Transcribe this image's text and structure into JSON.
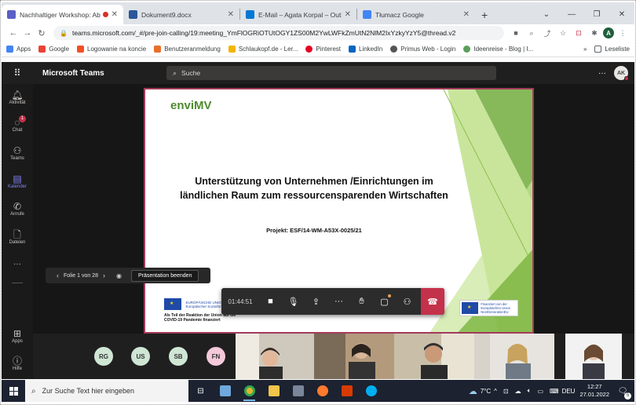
{
  "browser": {
    "tabs": [
      {
        "title": "Nachhaltiger Workshop: Abla",
        "active": true,
        "recording": true
      },
      {
        "title": "Dokument9.docx",
        "active": false
      },
      {
        "title": "E-Mail – Agata Korpal – Outlook",
        "active": false
      },
      {
        "title": "Tłumacz Google",
        "active": false
      }
    ],
    "url": "teams.microsoft.com/_#/pre-join-calling/19:meeting_YmFlOGRiOTUtOGY1ZS00M2YwLWFkZmUtN2NlM2IxYzkyYzY5@thread.v2",
    "bookmarks": [
      "Apps",
      "Google",
      "Logowanie na koncie",
      "Benutzeranmeldung",
      "Schlaukopf.de - Ler...",
      "Pinterest",
      "LinkedIn",
      "Primus Web - Login",
      "Ideenreise - Blog | I..."
    ],
    "bookmarks_more": "»",
    "reading_list": "Leseliste",
    "profile_initial": "A"
  },
  "teams": {
    "title": "Microsoft Teams",
    "search_placeholder": "Suche",
    "user_initials": "AK",
    "rail": [
      {
        "label": "Aktivität",
        "icon": "bell-icon"
      },
      {
        "label": "Chat",
        "icon": "chat-icon",
        "badge": "1"
      },
      {
        "label": "Teams",
        "icon": "teams-icon"
      },
      {
        "label": "Kalender",
        "icon": "calendar-icon",
        "active": true
      },
      {
        "label": "Anrufe",
        "icon": "phone-icon"
      },
      {
        "label": "Dateien",
        "icon": "files-icon"
      },
      {
        "label": "Apps",
        "icon": "apps-icon"
      },
      {
        "label": "Hilfe",
        "icon": "help-icon"
      }
    ],
    "rail_more": "···"
  },
  "slide": {
    "logo": "enviMV",
    "title_line1": "Unterstützung von Unternehmen /Einrichtungen im",
    "title_line2": "ländlichen Raum zum ressourcensparenden Wirtschaften",
    "project": "Projekt: ESF/14-WM-A53X-0025/21",
    "eu_left_text": "EUROPÄISCHE UNION Europäischer Sozialfonds",
    "eu_note": "Als Teil der Reaktion der Union auf die COVID-19 Pandemie finanziert",
    "eu_right_text": "Finanziert von der Europäischen Union NextGenerationEU"
  },
  "pager": {
    "slide_label": "Folie 1 von 28",
    "end_button": "Präsentation beenden"
  },
  "controls": {
    "timer": "01:44:51"
  },
  "participants": [
    "RG",
    "US",
    "SB",
    "FN"
  ],
  "taskbar": {
    "search_placeholder": "Zur Suche Text hier eingeben",
    "temperature": "7°C",
    "language": "DEU",
    "time": "12:27",
    "date": "27.01.2022",
    "notifications": "5"
  }
}
